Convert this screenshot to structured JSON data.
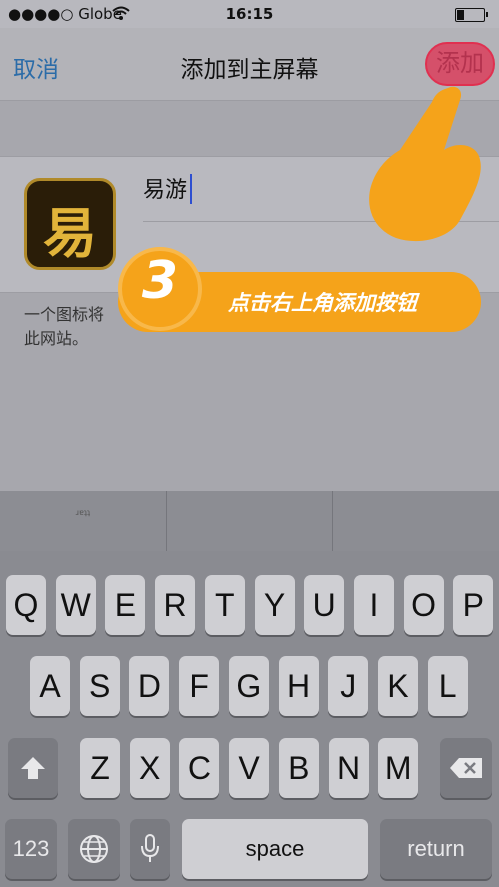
{
  "status_bar": {
    "carrier": "●●●●○ Globe",
    "time": "16:15"
  },
  "nav": {
    "cancel": "取消",
    "title": "添加到主屏幕",
    "add": "添加"
  },
  "app": {
    "name": "易游",
    "icon_glyph": "易"
  },
  "description": "一个图标将添加到您的主屏幕,以便快速访问此网站。",
  "description_visible": [
    "一个图标将",
    "此网站。"
  ],
  "overlay": {
    "step_number": "3",
    "instruction": "点击右上角添加按钮"
  },
  "suggestion": "ɹɐʇʇ",
  "keyboard": {
    "row1": [
      "Q",
      "W",
      "E",
      "R",
      "T",
      "Y",
      "U",
      "I",
      "O",
      "P"
    ],
    "row2": [
      "A",
      "S",
      "D",
      "F",
      "G",
      "H",
      "J",
      "K",
      "L"
    ],
    "row3": [
      "Z",
      "X",
      "C",
      "V",
      "B",
      "N",
      "M"
    ],
    "numbers_key": "123",
    "space_key": "space",
    "return_key": "return"
  },
  "colors": {
    "accent_orange": "#f5a31a",
    "nav_blue": "#2b6ca8",
    "highlight_red": "#e03050"
  },
  "icons": [
    "wifi-icon",
    "battery-icon",
    "globe-icon",
    "microphone-icon",
    "shift-icon",
    "delete-icon",
    "pointing-hand-icon"
  ]
}
